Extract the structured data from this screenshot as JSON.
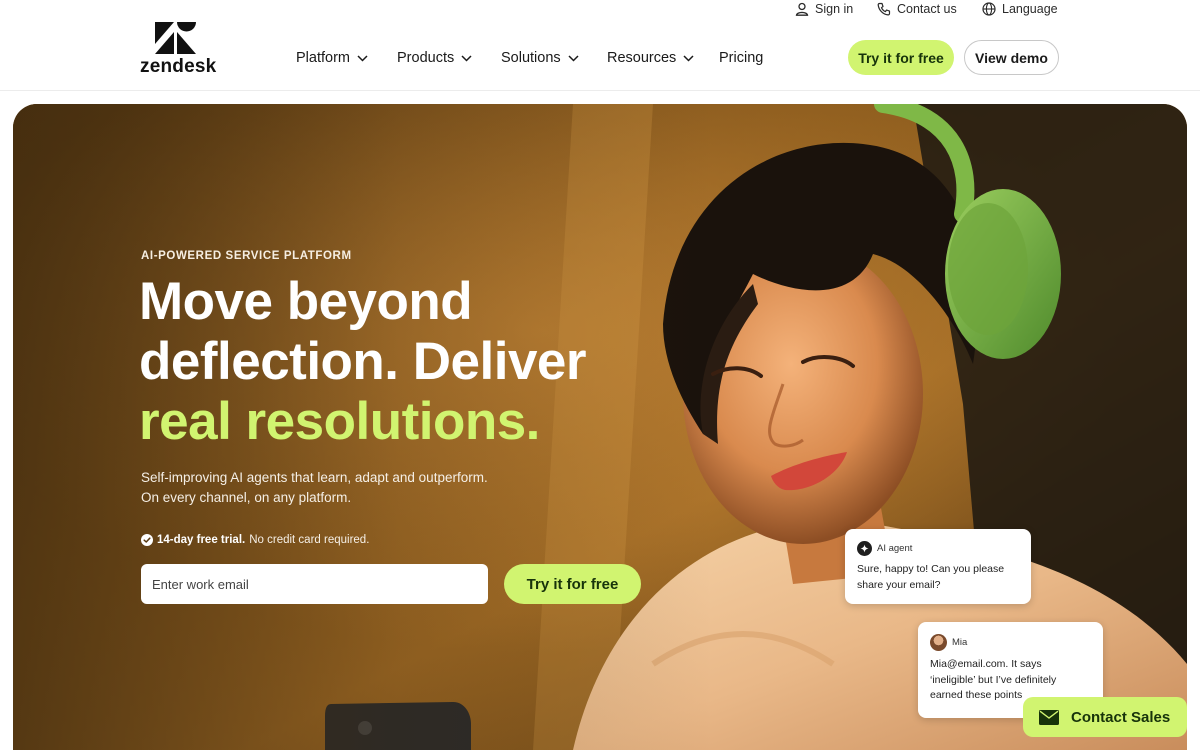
{
  "brand": {
    "name": "zendesk"
  },
  "utility_nav": {
    "sign_in": "Sign in",
    "contact_us": "Contact us",
    "language": "Language"
  },
  "main_nav": {
    "items": [
      {
        "label": "Platform",
        "has_dropdown": true
      },
      {
        "label": "Products",
        "has_dropdown": true
      },
      {
        "label": "Solutions",
        "has_dropdown": true
      },
      {
        "label": "Resources",
        "has_dropdown": true
      },
      {
        "label": "Pricing",
        "has_dropdown": false
      }
    ],
    "try_free": "Try it for free",
    "view_demo": "View demo"
  },
  "hero": {
    "eyebrow": "AI-POWERED SERVICE PLATFORM",
    "headline_line1": "Move beyond",
    "headline_line2": "deflection. Deliver",
    "headline_accent": "real resolutions.",
    "subtext_line1": "Self-improving AI agents that learn, adapt and outperform.",
    "subtext_line2": "On every channel, on any platform.",
    "trial_bold": "14-day free trial.",
    "trial_rest": "No credit card required.",
    "email_placeholder": "Enter work email",
    "cta": "Try it for free"
  },
  "chat": {
    "ai_name": "AI agent",
    "ai_line1": "Sure, happy to! Can you please",
    "ai_line2": "share your email?",
    "user_name": "Mia",
    "user_line1": "Mia@email.com. It says",
    "user_line2": "‘ineligible’ but I’ve definitely",
    "user_line3": "earned these points"
  },
  "contact_sales": "Contact Sales",
  "colors": {
    "accent": "#d1f470",
    "accent_text": "#17330a",
    "hero_bg": "#6a4516"
  },
  "icons": [
    "zendesk-logo",
    "person-icon",
    "phone-icon",
    "globe-icon",
    "chevron-down-icon",
    "check-circle-icon",
    "envelope-icon"
  ]
}
